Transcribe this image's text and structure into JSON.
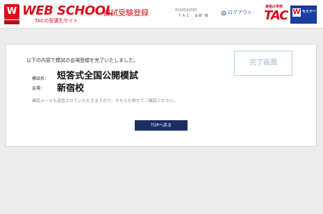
{
  "header": {
    "logo_mark": "W",
    "brand": "WEB SCHOOL",
    "brand_sub": "TACの受講生サイト",
    "page_title": "模試受験登録",
    "user_id": "0104034305",
    "user_name": "ＴＡＣ　太郎 様",
    "logout_label": "ログアウト",
    "tac_tag": "資格の学校",
    "tac_word": "TAC",
    "tac_badge_letter": "W",
    "tac_badge_text": "セミナー",
    "colors": {
      "brand_red": "#d8101c",
      "badge_blue": "#1a3fa0",
      "link_blue": "#3d5fb0"
    }
  },
  "main": {
    "intro": "以下の内容で模試の会場登録を完了いたしました。",
    "complete_label": "完了画面",
    "fields": [
      {
        "label": "模試名：",
        "value": "短答式全国公開模試"
      },
      {
        "label": "会場：",
        "value": "新宿校"
      }
    ],
    "note": "確認メールも送信させていただきますので、そちらも併せてご確認ください。",
    "top_button": "TOPへ戻る",
    "colors": {
      "button_bg": "#1c2f63"
    }
  }
}
